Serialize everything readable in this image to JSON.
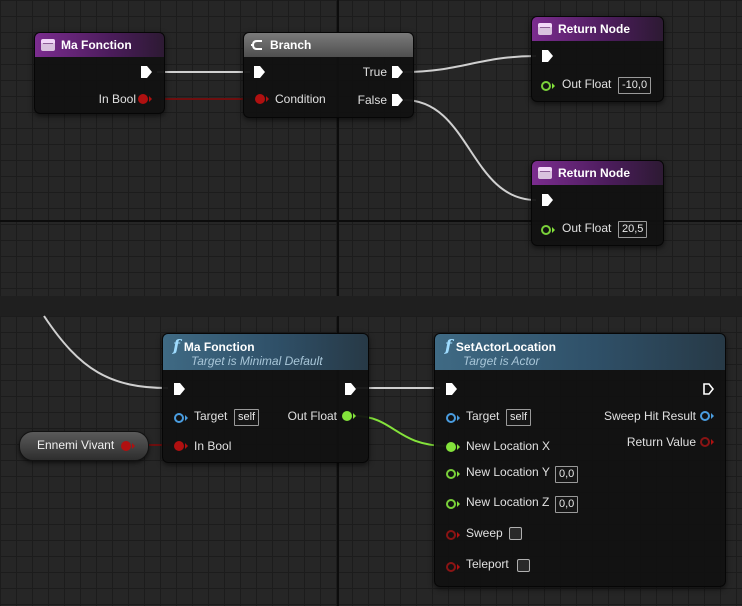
{
  "colors": {
    "bool_pin": "#b01010",
    "float_pin": "#84e33b",
    "object_pin": "#4a9de0",
    "exec_wire": "#d0d0d0",
    "function_header": "#7b2c8f"
  },
  "top": {
    "entry_node": {
      "title": "Ma Fonction",
      "icon": "function-entry-icon",
      "in_bool": "In Bool"
    },
    "branch_node": {
      "title": "Branch",
      "icon": "branch-icon",
      "condition": "Condition",
      "true_label": "True",
      "false_label": "False"
    },
    "return_node_1": {
      "title": "Return Node",
      "icon": "function-entry-icon",
      "out_float": "Out Float",
      "value": "-10,0"
    },
    "return_node_2": {
      "title": "Return Node",
      "icon": "function-entry-icon",
      "out_float": "Out Float",
      "value": "20,5"
    }
  },
  "bottom": {
    "call_node": {
      "icon_text": "f",
      "title": "Ma Fonction",
      "subtitle": "Target is Minimal Default",
      "target": "Target",
      "target_value": "self",
      "in_bool": "In Bool",
      "out_float": "Out Float"
    },
    "variable_node": {
      "label": "Ennemi Vivant"
    },
    "set_actor_node": {
      "icon_text": "f",
      "title": "SetActorLocation",
      "subtitle": "Target is Actor",
      "target": "Target",
      "target_value": "self",
      "new_location_x": "New Location X",
      "new_location_y": "New Location Y",
      "new_location_y_value": "0,0",
      "new_location_z": "New Location Z",
      "new_location_z_value": "0,0",
      "sweep": "Sweep",
      "teleport": "Teleport",
      "sweep_hit_result": "Sweep Hit Result",
      "return_value": "Return Value"
    }
  }
}
